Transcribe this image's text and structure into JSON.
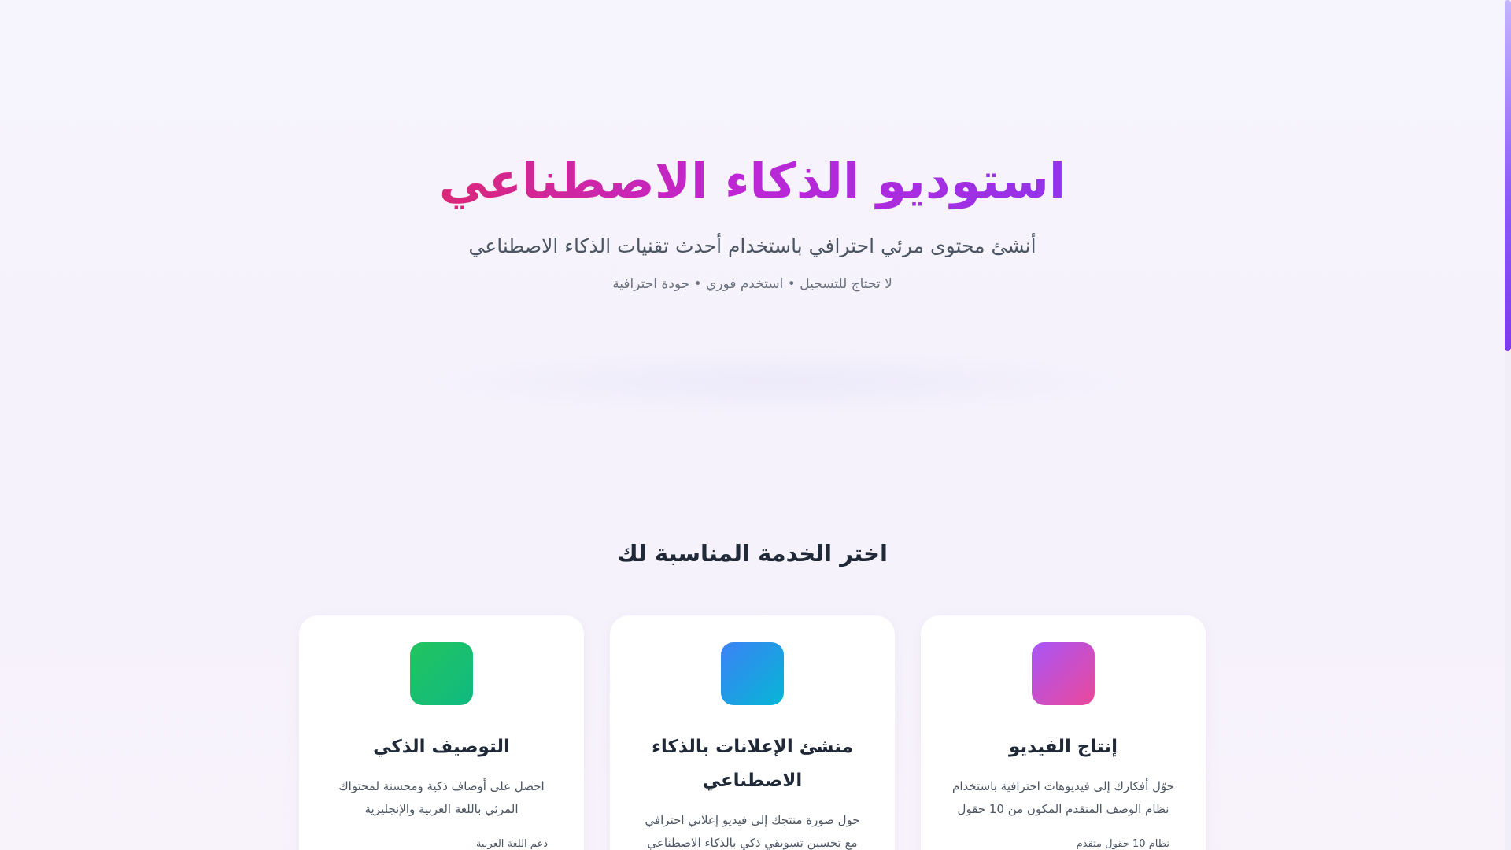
{
  "hero": {
    "title": "استوديو الذكاء الاصطناعي",
    "subtitle": "أنشئ محتوى مرئي احترافي باستخدام أحدث تقنيات الذكاء الاصطناعي",
    "note": "لا تحتاج للتسجيل • استخدم فوري • جودة احترافية"
  },
  "services": {
    "title": "اختر الخدمة المناسبة لك",
    "cards": [
      {
        "title": "إنتاج الفيديو",
        "description": "حوّل أفكارك إلى فيديوهات احترافية باستخدام نظام الوصف المتقدم المكون من 10 حقول",
        "feature": "نظام 10 حقول متقدم",
        "icon": "video-icon",
        "icon_gradient": [
          "#a855f7",
          "#ec4899"
        ]
      },
      {
        "title": "منشئ الإعلانات بالذكاء الاصطناعي",
        "description": "حول صورة منتجك إلى فيديو إعلاني احترافي مع تحسين تسويقي ذكي بالذكاء الاصطناعي",
        "feature": "",
        "icon": "ad-icon",
        "icon_gradient": [
          "#3b82f6",
          "#06b6d4"
        ]
      },
      {
        "title": "التوصيف الذكي",
        "description": "احصل على أوصاف ذكية ومحسنة لمحتواك المرئي باللغة العربية والإنجليزية",
        "feature": "دعم اللغة العربية",
        "icon": "description-icon",
        "icon_gradient": [
          "#22c55e",
          "#10b981"
        ]
      }
    ]
  },
  "colors": {
    "title_gradient": [
      "#db2777",
      "#c026d3",
      "#9333ea"
    ],
    "scrollbar_accent": "#8b5cf6"
  }
}
